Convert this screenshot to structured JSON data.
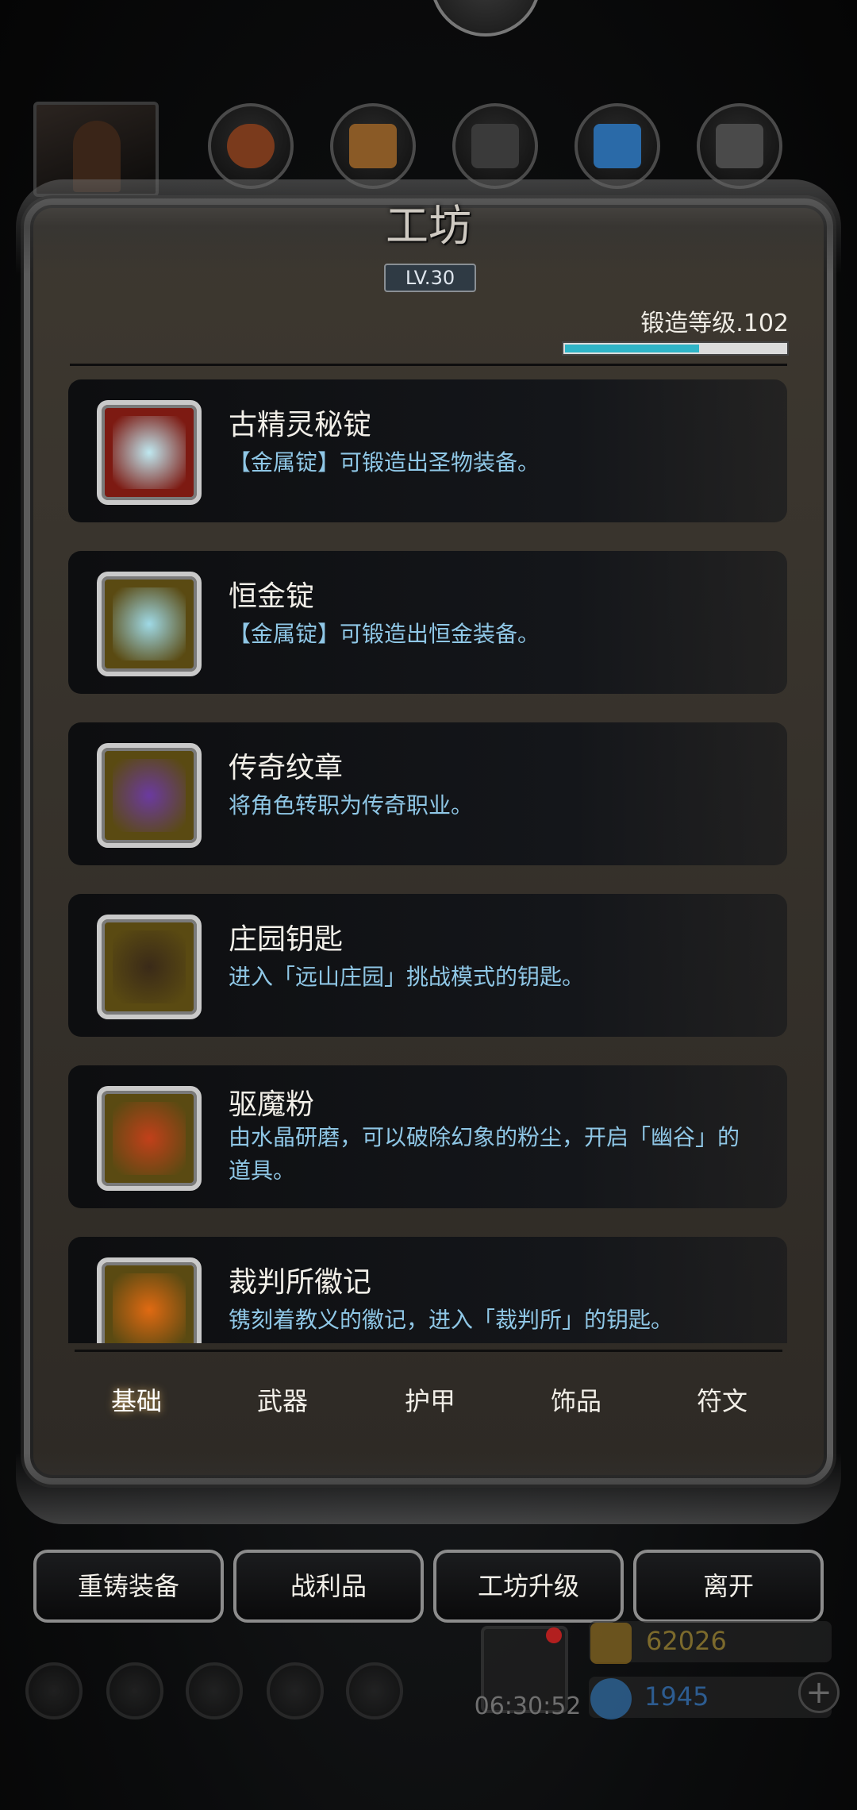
{
  "header": {
    "title": "工坊",
    "level": "LV.30",
    "forge_level_label": "锻造等级.102",
    "forge_progress": 0.6
  },
  "top_icons": [
    "character-portrait-icon",
    "meat-icon",
    "wood-icon",
    "stone-icon",
    "crystal-icon",
    "ore-icon"
  ],
  "items": [
    {
      "name": "古精灵秘锭",
      "desc": "【金属锭】可锻造出圣物装备。",
      "icon": "ancient-ingot-icon",
      "frame": "#7d1a12",
      "core": "#bfe8f0"
    },
    {
      "name": "恒金锭",
      "desc": "【金属锭】可锻造出恒金装备。",
      "icon": "eternal-ingot-icon",
      "frame": "#5a4a12",
      "core": "#9fd9e6"
    },
    {
      "name": "传奇纹章",
      "desc": "将角色转职为传奇职业。",
      "icon": "legend-crest-icon",
      "frame": "#5a4a12",
      "core": "#6b3aa0"
    },
    {
      "name": "庄园钥匙",
      "desc": "进入「远山庄园」挑战模式的钥匙。",
      "icon": "manor-key-icon",
      "frame": "#5a4a12",
      "core": "#3a2a18"
    },
    {
      "name": "驱魔粉",
      "desc": "由水晶研磨，可以破除幻象的粉尘，开启「幽谷」的道具。",
      "icon": "exorcism-powder-icon",
      "frame": "#5a4a12",
      "core": "#c2401a"
    },
    {
      "name": "裁判所徽记",
      "desc": "镌刻着教义的徽记，进入「裁判所」的钥匙。",
      "icon": "tribunal-emblem-icon",
      "frame": "#5a4a12",
      "core": "#e06a12"
    }
  ],
  "tabs": [
    "基础",
    "武器",
    "护甲",
    "饰品",
    "符文"
  ],
  "active_tab": 0,
  "actions": [
    "重铸装备",
    "战利品",
    "工坊升级",
    "离开"
  ],
  "footer": {
    "gold": "62026",
    "gems": "1945",
    "timer": "06:30:52"
  }
}
